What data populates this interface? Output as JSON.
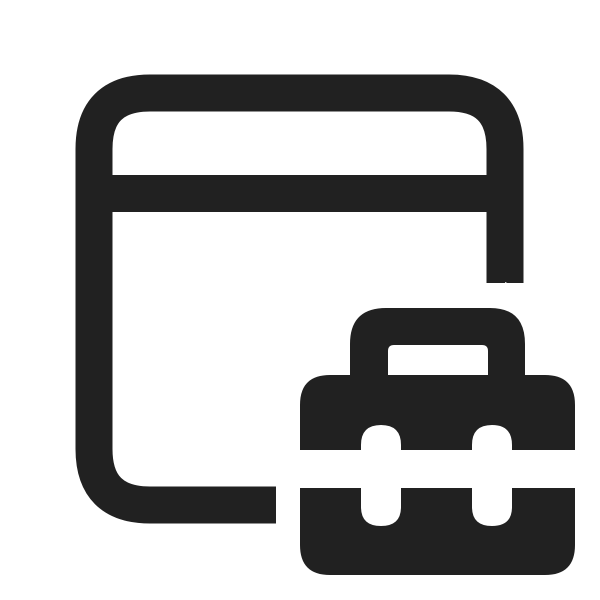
{
  "icon": {
    "semantic": "app-window-toolbox-icon",
    "color": "#212121",
    "background": "#ffffff",
    "parts": [
      "window-frame-icon",
      "window-title-bar",
      "toolbox-icon"
    ]
  }
}
